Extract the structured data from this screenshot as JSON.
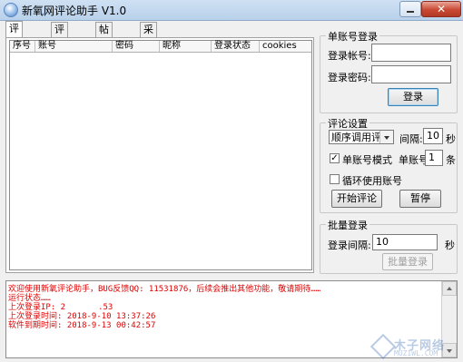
{
  "window": {
    "title": "新氧网评论助手 V1.0",
    "close_glyph": "✕"
  },
  "tabs": [
    {
      "label": "评论账号",
      "active": true
    },
    {
      "label": "评论内容",
      "active": false
    },
    {
      "label": "帖子链接",
      "active": false
    },
    {
      "label": "采集评论",
      "active": false
    }
  ],
  "table": {
    "columns": [
      "序号",
      "账号",
      "密码",
      "昵称",
      "登录状态",
      "cookies"
    ],
    "rows": []
  },
  "single_login": {
    "group_title": "单账号登录",
    "account_label": "登录帐号:",
    "account_value": "",
    "password_label": "登录密码:",
    "password_value": "",
    "login_button": "登录"
  },
  "comment_settings": {
    "group_title": "评论设置",
    "mode_selected": "顺序调用评论",
    "interval_label": "间隔:",
    "interval_value": "10",
    "interval_unit": "秒",
    "single_mode_label": "单账号模式",
    "single_mode_checked": true,
    "single_account_label": "单账号:",
    "single_account_value": "1",
    "single_account_unit": "条",
    "loop_label": "循环使用账号",
    "loop_checked": false,
    "start_button": "开始评论",
    "pause_button": "暂停"
  },
  "batch_login": {
    "group_title": "批量登录",
    "interval_label": "登录间隔:",
    "interval_value": "10",
    "interval_unit": "秒",
    "button": "批量登录"
  },
  "log": {
    "line1": "欢迎使用新氧评论助手，BUG反馈QQ: 11531876，后续会推出其他功能，敬请期待……",
    "line2": "运行状态……",
    "line3a": "上次登录IP: 2",
    "line3b": ".53",
    "line4": "上次登录时间: 2018-9-10 13:37:26",
    "line5": "软件到期时间: 2018-9-13 00:42:57"
  },
  "watermark": {
    "text": "木子网络",
    "sub": "MUZIWL.COM"
  }
}
